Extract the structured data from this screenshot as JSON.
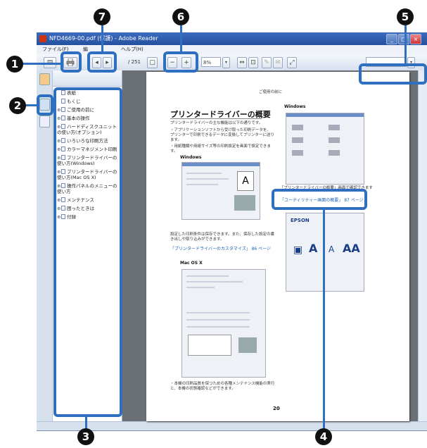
{
  "window": {
    "title": "NFD4669-00.pdf (保護) - Adobe Reader",
    "buttons": [
      "_",
      "□",
      "×"
    ]
  },
  "menubar": {
    "items": [
      "ファイル(F)",
      "編",
      "ヘルプ(H)"
    ]
  },
  "toolbar": {
    "print_icon": "printer-icon",
    "page_total": "/ 251",
    "zoom_out": "−",
    "zoom_in": "+",
    "zoom_value": "8%",
    "prev_page": "◂",
    "next_page": "▸",
    "search_placeholder": ""
  },
  "bookmarks": {
    "items": [
      {
        "toggle": "",
        "label": "表紙"
      },
      {
        "toggle": "",
        "label": "もくじ"
      },
      {
        "toggle": "⊕",
        "label": "ご使用の前に"
      },
      {
        "toggle": "⊕",
        "label": "基本の操作"
      },
      {
        "toggle": "⊕",
        "label": "ハードディスクユニットの使い方(オプション)"
      },
      {
        "toggle": "⊕",
        "label": "いろいろな印刷方法"
      },
      {
        "toggle": "⊕",
        "label": "カラーマネジメント印刷"
      },
      {
        "toggle": "⊕",
        "label": "プリンタードライバーの使い方(Windows)"
      },
      {
        "toggle": "⊕",
        "label": "プリンタードライバーの使い方(Mac OS X)"
      },
      {
        "toggle": "⊕",
        "label": "操作パネルのメニューの使い方"
      },
      {
        "toggle": "⊕",
        "label": "メンテナンス"
      },
      {
        "toggle": "⊕",
        "label": "困ったときは"
      },
      {
        "toggle": "⊕",
        "label": "付録"
      }
    ]
  },
  "page": {
    "header": "ご使用の前に",
    "title": "プリンタードライバーの概要",
    "intro1": "プリンタードライバーの主な機能は以下の通りです。",
    "intro2": "・アプリケーションソフトから受け取った印刷データを、プリンターで印刷できるデータに変換してプリンターに送ります。",
    "intro3": "・用紙種類や用紙サイズ等の印刷設定を画面で設定できます。",
    "windows_label": "Windows",
    "para2": "設定した印刷条件は保存できます。また、保存した設定の書き出しや取り込みができます。",
    "link1": "「プリンタードライバーのカスタマイズ」 86 ページ",
    "mac_label": "Mac OS X",
    "bottom_note": "・本機の印刷品質を保つための各種メンテナンス機能の実行と、本機の状態確認などができます。",
    "right_windows_label": "Windows",
    "right_caption": "「プリンタードライバーの概要」画面で確認できます",
    "link2": "「ユーティリティー画面の概要」 87 ページ",
    "epson_label": "EPSON",
    "page_number": "20"
  },
  "callouts": [
    "1",
    "2",
    "3",
    "4",
    "5",
    "6",
    "7"
  ]
}
